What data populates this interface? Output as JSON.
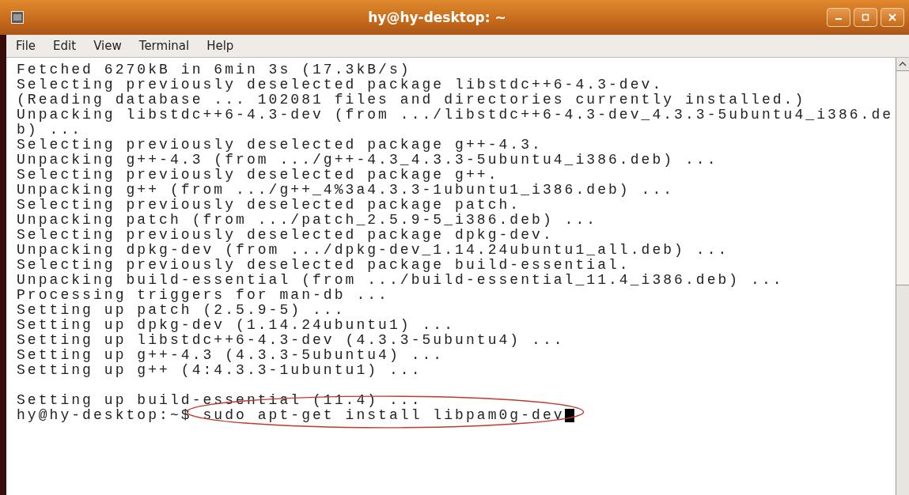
{
  "window": {
    "title": "hy@hy-desktop: ~"
  },
  "menu": [
    "File",
    "Edit",
    "View",
    "Terminal",
    "Help"
  ],
  "terminal": {
    "lines": [
      "Fetched 6270kB in 6min 3s (17.3kB/s)",
      "Selecting previously deselected package libstdc++6-4.3-dev.",
      "(Reading database ... 102081 files and directories currently installed.)",
      "Unpacking libstdc++6-4.3-dev (from .../libstdc++6-4.3-dev_4.3.3-5ubuntu4_i386.de",
      "b) ...",
      "Selecting previously deselected package g++-4.3.",
      "Unpacking g++-4.3 (from .../g++-4.3_4.3.3-5ubuntu4_i386.deb) ...",
      "Selecting previously deselected package g++.",
      "Unpacking g++ (from .../g++_4%3a4.3.3-1ubuntu1_i386.deb) ...",
      "Selecting previously deselected package patch.",
      "Unpacking patch (from .../patch_2.5.9-5_i386.deb) ...",
      "Selecting previously deselected package dpkg-dev.",
      "Unpacking dpkg-dev (from .../dpkg-dev_1.14.24ubuntu1_all.deb) ...",
      "Selecting previously deselected package build-essential.",
      "Unpacking build-essential (from .../build-essential_11.4_i386.deb) ...",
      "Processing triggers for man-db ...",
      "Setting up patch (2.5.9-5) ...",
      "Setting up dpkg-dev (1.14.24ubuntu1) ...",
      "Setting up libstdc++6-4.3-dev (4.3.3-5ubuntu4) ...",
      "Setting up g++-4.3 (4.3.3-5ubuntu4) ...",
      "Setting up g++ (4:4.3.3-1ubuntu1) ..."
    ],
    "lines_after_blank": [
      "Setting up build-essential (11.4) ..."
    ],
    "prompt": "hy@hy-desktop:~$",
    "command": "sudo apt-get install libpam0g-dev"
  }
}
